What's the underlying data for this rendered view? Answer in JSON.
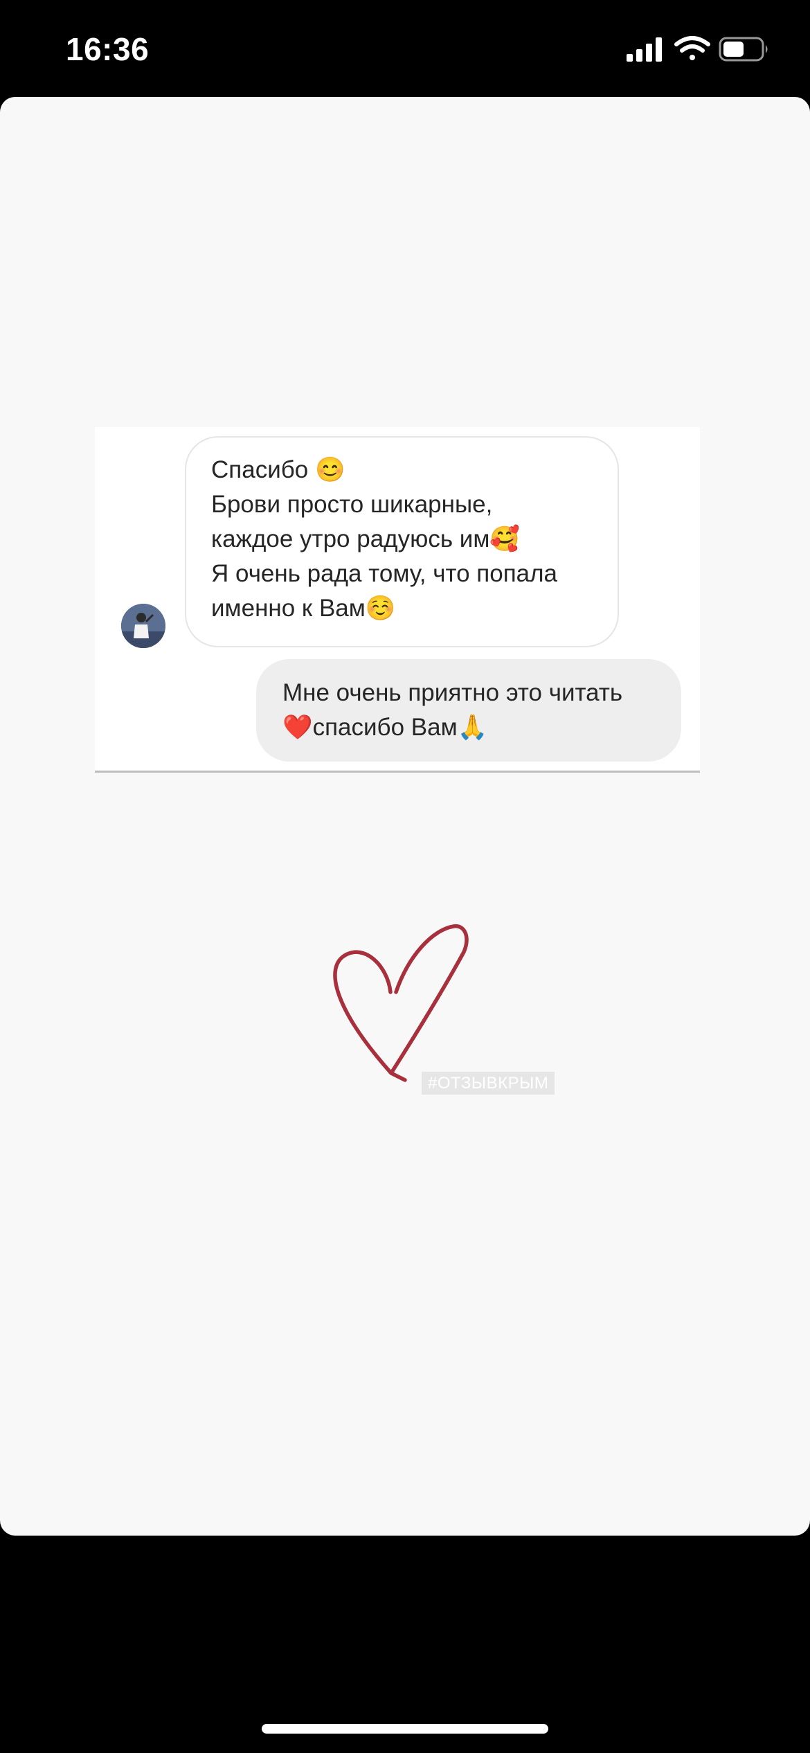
{
  "status_bar": {
    "time": "16:36",
    "icons": [
      "cellular-signal-icon",
      "wifi-icon",
      "battery-icon"
    ]
  },
  "chat": {
    "incoming": {
      "lines": [
        "Спасибо 😊",
        "Брови просто шикарные,",
        "каждое утро радуюсь им🥰",
        "Я очень рада тому, что попала",
        "именно к Вам☺️"
      ]
    },
    "outgoing": {
      "lines": [
        "Мне очень приятно это читать",
        "❤️спасибо Вам🙏"
      ]
    }
  },
  "sticker": {
    "hashtag": "#ОТЗЫВКРЫМ",
    "heart_color": "#a8303d"
  },
  "colors": {
    "story_background": "#f9f8f8",
    "incoming_bubble_border": "#e5e5e5",
    "outgoing_bubble_fill": "#eeeeee"
  }
}
